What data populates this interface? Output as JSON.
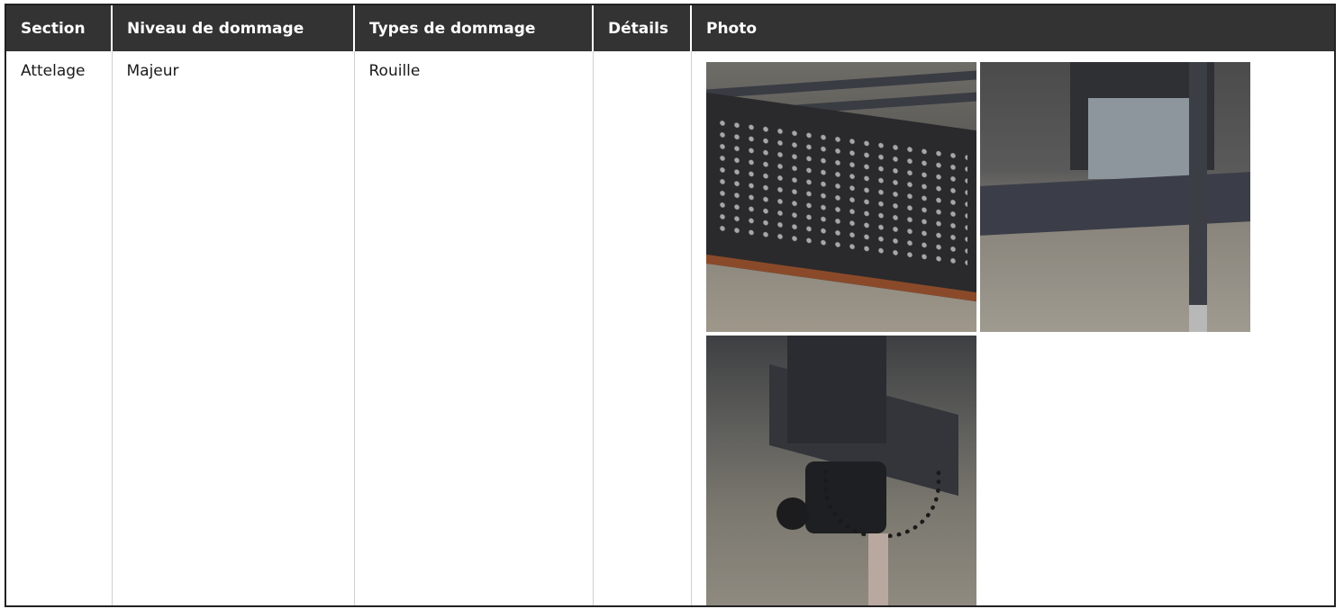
{
  "table": {
    "headers": [
      "Section",
      "Niveau de dommage",
      "Types de dommage",
      "Détails",
      "Photo"
    ],
    "rows": [
      {
        "section": "Attelage",
        "niveau": "Majeur",
        "types": "Rouille",
        "details": "",
        "photos": [
          "rusty-step-plate",
          "trailer-frame-jack",
          "hitch-coupler-chains"
        ]
      }
    ]
  },
  "colors": {
    "header_bg": "#333333",
    "header_text": "#ffffff",
    "border": "#222222"
  }
}
